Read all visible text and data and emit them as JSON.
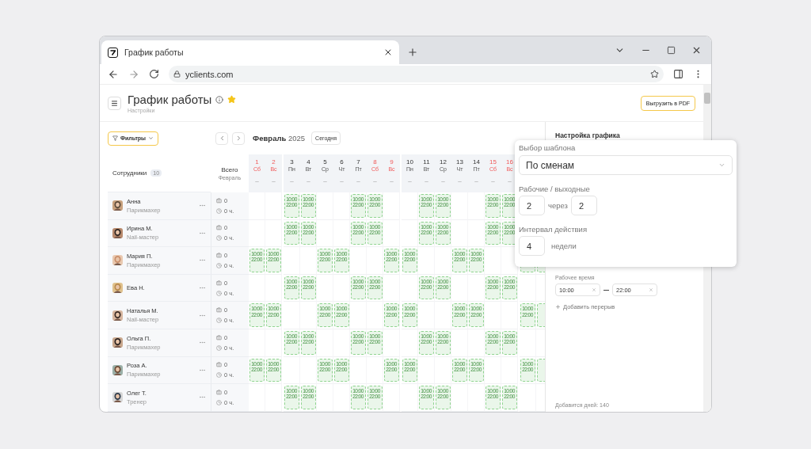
{
  "browser": {
    "tab_title": "График работы",
    "address": "yclients.com"
  },
  "page": {
    "title": "График работы",
    "subtitle": "Настройки",
    "starred": true,
    "export_button": "Выгрузить в PDF"
  },
  "toolbar": {
    "filter_button": "Фильтры",
    "month": "Февраль",
    "year": "2025",
    "today_button": "Сегодня"
  },
  "table": {
    "employees_heading": "Сотрудники",
    "employees_count": "10",
    "total_heading": "Всего",
    "total_subheading": "Февраль",
    "days": [
      {
        "day": "1",
        "weekday": "Сб",
        "weekend": true,
        "note": "–"
      },
      {
        "day": "2",
        "weekday": "Вс",
        "weekend": true,
        "note": "–"
      },
      {
        "day": "3",
        "weekday": "Пн",
        "weekend": false,
        "note": "–"
      },
      {
        "day": "4",
        "weekday": "Вт",
        "weekend": false,
        "note": "–"
      },
      {
        "day": "5",
        "weekday": "Ср",
        "weekend": false,
        "note": "–"
      },
      {
        "day": "6",
        "weekday": "Чт",
        "weekend": false,
        "note": "–"
      },
      {
        "day": "7",
        "weekday": "Пт",
        "weekend": false,
        "note": "–"
      },
      {
        "day": "8",
        "weekday": "Сб",
        "weekend": true,
        "note": "–"
      },
      {
        "day": "9",
        "weekday": "Вс",
        "weekend": true,
        "note": "–"
      },
      {
        "day": "10",
        "weekday": "Пн",
        "weekend": false,
        "note": "–"
      },
      {
        "day": "11",
        "weekday": "Вт",
        "weekend": false,
        "note": "–"
      },
      {
        "day": "12",
        "weekday": "Ср",
        "weekend": false,
        "note": "–"
      },
      {
        "day": "13",
        "weekday": "Чт",
        "weekend": false,
        "note": "–"
      },
      {
        "day": "14",
        "weekday": "Пт",
        "weekend": false,
        "note": "–"
      },
      {
        "day": "15",
        "weekday": "Сб",
        "weekend": true,
        "note": "–"
      },
      {
        "day": "16",
        "weekday": "Вс",
        "weekend": true,
        "note": "–"
      }
    ],
    "rows": [
      {
        "name": "Анна",
        "role": "Парикмахер",
        "visits": "0",
        "hours": "0 ч.",
        "shifts": [
          {
            "on": false
          },
          {
            "on": false
          },
          {
            "on": true,
            "start": "10:00",
            "end": "22:00"
          },
          {
            "on": true,
            "start": "10:00",
            "end": "22:00"
          },
          {
            "on": false
          },
          {
            "on": false
          },
          {
            "on": true,
            "start": "10:00",
            "end": "22:00"
          },
          {
            "on": true,
            "start": "10:00",
            "end": "22:00"
          },
          {
            "on": false
          },
          {
            "on": false
          },
          {
            "on": true,
            "start": "10:00",
            "end": "22:00"
          },
          {
            "on": true,
            "start": "10:00",
            "end": "22:00"
          },
          {
            "on": false
          },
          {
            "on": false
          },
          {
            "on": true,
            "start": "10:00",
            "end": "22:00"
          },
          {
            "on": true,
            "start": "10:00",
            "end": "22:00"
          }
        ]
      },
      {
        "name": "Ирина М.",
        "role": "Nail-мастер",
        "visits": "0",
        "hours": "0 ч.",
        "shifts": [
          {
            "on": false
          },
          {
            "on": false
          },
          {
            "on": true,
            "start": "10:00",
            "end": "22:00"
          },
          {
            "on": true,
            "start": "10:00",
            "end": "22:00"
          },
          {
            "on": false
          },
          {
            "on": false
          },
          {
            "on": true,
            "start": "10:00",
            "end": "22:00"
          },
          {
            "on": true,
            "start": "10:00",
            "end": "22:00"
          },
          {
            "on": false
          },
          {
            "on": false
          },
          {
            "on": true,
            "start": "10:00",
            "end": "22:00"
          },
          {
            "on": true,
            "start": "10:00",
            "end": "22:00"
          },
          {
            "on": false
          },
          {
            "on": false
          },
          {
            "on": true,
            "start": "10:00",
            "end": "22:00"
          },
          {
            "on": true,
            "start": "10:00",
            "end": "22:00"
          }
        ]
      },
      {
        "name": "Мария П.",
        "role": "Парикмахер",
        "visits": "0",
        "hours": "0 ч.",
        "shifts": [
          {
            "on": true,
            "start": "10:00",
            "end": "22:00"
          },
          {
            "on": true,
            "start": "10:00",
            "end": "22:00"
          },
          {
            "on": false
          },
          {
            "on": false
          },
          {
            "on": true,
            "start": "10:00",
            "end": "22:00"
          },
          {
            "on": true,
            "start": "10:00",
            "end": "22:00"
          },
          {
            "on": false
          },
          {
            "on": false
          },
          {
            "on": true,
            "start": "10:00",
            "end": "22:00"
          },
          {
            "on": true,
            "start": "10:00",
            "end": "22:00"
          },
          {
            "on": false
          },
          {
            "on": false
          },
          {
            "on": true,
            "start": "10:00",
            "end": "22:00"
          },
          {
            "on": true,
            "start": "10:00",
            "end": "22:00"
          },
          {
            "on": false
          },
          {
            "on": false
          },
          {
            "on": true
          },
          {
            "on": true
          }
        ]
      },
      {
        "name": "Ева Н.",
        "visits": "0",
        "hours": "0 ч.",
        "shifts": [
          {
            "on": false
          },
          {
            "on": false
          },
          {
            "on": true,
            "start": "10:00",
            "end": "22:00"
          },
          {
            "on": true,
            "start": "10:00",
            "end": "22:00"
          },
          {
            "on": false
          },
          {
            "on": false
          },
          {
            "on": true,
            "start": "10:00",
            "end": "22:00"
          },
          {
            "on": true,
            "start": "10:00",
            "end": "22:00"
          },
          {
            "on": false
          },
          {
            "on": false
          },
          {
            "on": true,
            "start": "10:00",
            "end": "22:00"
          },
          {
            "on": true,
            "start": "10:00",
            "end": "22:00"
          },
          {
            "on": false
          },
          {
            "on": false
          },
          {
            "on": true,
            "start": "10:00",
            "end": "22:00"
          },
          {
            "on": true,
            "start": "10:00",
            "end": "22:00"
          },
          {
            "on": false
          },
          {
            "on": false
          }
        ]
      },
      {
        "name": "Наталья М.",
        "role": "Nail-мастер",
        "visits": "0",
        "hours": "0 ч.",
        "shifts": [
          {
            "on": true,
            "start": "10:00",
            "end": "22:00"
          },
          {
            "on": true,
            "start": "10:00",
            "end": "22:00"
          },
          {
            "on": false
          },
          {
            "on": false
          },
          {
            "on": true,
            "start": "10:00",
            "end": "22:00"
          },
          {
            "on": true,
            "start": "10:00",
            "end": "22:00"
          },
          {
            "on": false
          },
          {
            "on": false
          },
          {
            "on": true,
            "start": "10:00",
            "end": "22:00"
          },
          {
            "on": true,
            "start": "10:00",
            "end": "22:00"
          },
          {
            "on": false
          },
          {
            "on": false
          },
          {
            "on": true,
            "start": "10:00",
            "end": "22:00"
          },
          {
            "on": true,
            "start": "10:00",
            "end": "22:00"
          },
          {
            "on": false
          },
          {
            "on": false
          },
          {
            "on": true,
            "start": "10:00",
            "end": "22:00"
          },
          {
            "on": true
          }
        ]
      },
      {
        "name": "Ольга П.",
        "role": "Парикмахер",
        "visits": "0",
        "hours": "0 ч.",
        "shifts": [
          {
            "on": false
          },
          {
            "on": false
          },
          {
            "on": true,
            "start": "10:00",
            "end": "22:00"
          },
          {
            "on": true,
            "start": "10:00",
            "end": "22:00"
          },
          {
            "on": false
          },
          {
            "on": false
          },
          {
            "on": true,
            "start": "10:00",
            "end": "22:00"
          },
          {
            "on": true,
            "start": "10:00",
            "end": "22:00"
          },
          {
            "on": false
          },
          {
            "on": false
          },
          {
            "on": true,
            "start": "10:00",
            "end": "22:00"
          },
          {
            "on": true,
            "start": "10:00",
            "end": "22:00"
          },
          {
            "on": false
          },
          {
            "on": false
          },
          {
            "on": true,
            "start": "10:00",
            "end": "22:00"
          },
          {
            "on": true,
            "start": "10:00",
            "end": "22:00"
          },
          {
            "on": false
          },
          {
            "on": false
          }
        ]
      },
      {
        "name": "Роза А.",
        "role": "Парикмахер",
        "visits": "0",
        "hours": "0 ч.",
        "shifts": [
          {
            "on": true,
            "start": "10:00",
            "end": "22:00"
          },
          {
            "on": true,
            "start": "10:00",
            "end": "22:00"
          },
          {
            "on": false
          },
          {
            "on": false
          },
          {
            "on": true,
            "start": "10:00",
            "end": "22:00"
          },
          {
            "on": true,
            "start": "10:00",
            "end": "22:00"
          },
          {
            "on": false
          },
          {
            "on": false
          },
          {
            "on": true,
            "start": "10:00",
            "end": "22:00"
          },
          {
            "on": true,
            "start": "10:00",
            "end": "22:00"
          },
          {
            "on": false
          },
          {
            "on": false
          },
          {
            "on": true,
            "start": "10:00",
            "end": "22:00"
          },
          {
            "on": true,
            "start": "10:00",
            "end": "22:00"
          },
          {
            "on": false
          },
          {
            "on": false
          },
          {
            "on": true,
            "start": "10:00",
            "end": "22:00"
          },
          {
            "on": true
          }
        ]
      },
      {
        "name": "Олег Т.",
        "role": "Тренер",
        "visits": "0",
        "hours": "0 ч.",
        "shifts": [
          {
            "on": false
          },
          {
            "on": false
          },
          {
            "on": true,
            "start": "10:00",
            "end": "22:00"
          },
          {
            "on": true,
            "start": "10:00",
            "end": "22:00"
          },
          {
            "on": false
          },
          {
            "on": false
          },
          {
            "on": true,
            "start": "10:00",
            "end": "22:00"
          },
          {
            "on": true,
            "start": "10:00",
            "end": "22:00"
          },
          {
            "on": false
          },
          {
            "on": false
          },
          {
            "on": true,
            "start": "10:00",
            "end": "22:00"
          },
          {
            "on": true,
            "start": "10:00",
            "end": "22:00"
          },
          {
            "on": false
          },
          {
            "on": false
          },
          {
            "on": true,
            "start": "10:00",
            "end": "22:00"
          },
          {
            "on": true,
            "start": "10:00",
            "end": "22:00"
          },
          {
            "on": false
          },
          {
            "on": false
          }
        ]
      }
    ]
  },
  "settings_panel": {
    "title": "Настройка графика",
    "work_time_label": "Рабочее время",
    "time_from": "10:00",
    "time_to": "22:00",
    "add_break": "Добавить перерыв",
    "days_added": "Добавится дней: 140"
  },
  "template_popup": {
    "template_label": "Выбор шаблона",
    "template_value": "По сменам",
    "work_off_label": "Рабочие / выходные",
    "work_days": "2",
    "between": "через",
    "off_days": "2",
    "interval_label": "Интервал действия",
    "interval_value": "4",
    "interval_unit": "недели"
  }
}
